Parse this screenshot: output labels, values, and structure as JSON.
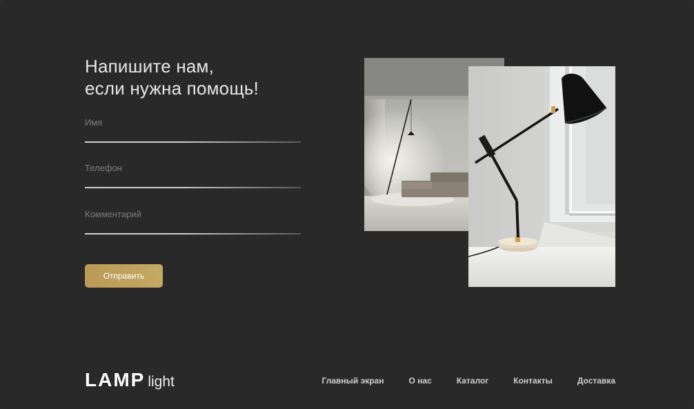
{
  "form": {
    "heading_line1": "Напишите нам,",
    "heading_line2": "если нужна помощь!",
    "fields": [
      {
        "placeholder": "Имя",
        "value": ""
      },
      {
        "placeholder": "Телефон",
        "value": ""
      },
      {
        "placeholder": "Комментарий",
        "value": ""
      }
    ],
    "submit_label": "Отправить"
  },
  "images": {
    "back": "living-room-floor-lamp-photo",
    "front": "black-desk-lamp-window-photo"
  },
  "footer": {
    "logo_bold": "LAMP",
    "logo_light": "light",
    "nav": [
      "Главный экран",
      "О нас",
      "Каталог",
      "Контакты",
      "Доставка"
    ]
  },
  "colors": {
    "background": "#292929",
    "accent": "#c0a05c"
  }
}
